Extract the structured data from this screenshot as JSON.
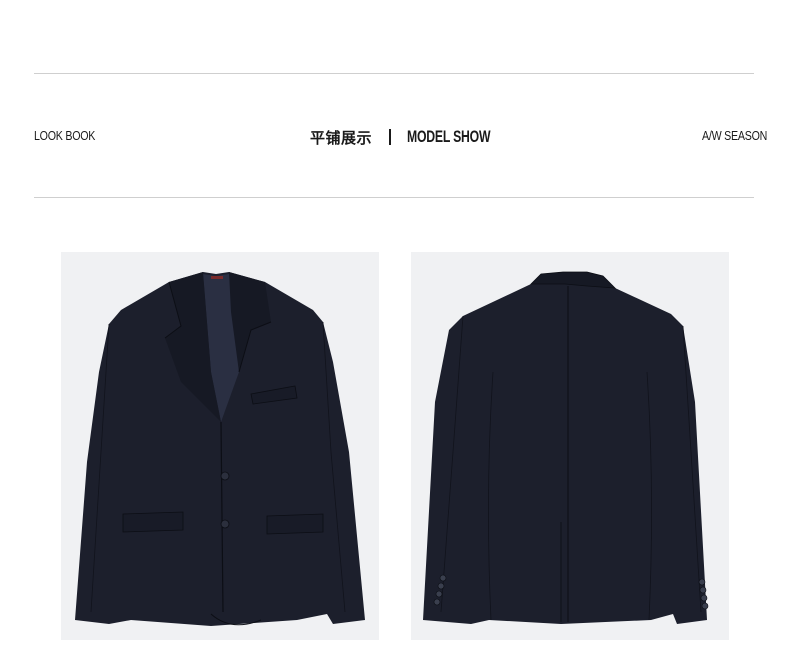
{
  "header": {
    "left_label": "LOOK BOOK",
    "center_cn": "平铺展示",
    "center_en": "MODEL SHOW",
    "right_label": "A/W SEASON"
  },
  "colors": {
    "rule": "#cfcfcf",
    "jacket": "#1c1f2c",
    "photo_bg": "#f0f1f3"
  },
  "products": [
    {
      "view": "front",
      "icon": "jacket-front-image"
    },
    {
      "view": "back",
      "icon": "jacket-back-image"
    }
  ]
}
